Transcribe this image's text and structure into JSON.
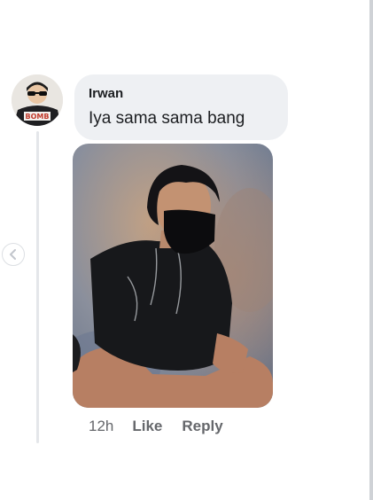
{
  "comment": {
    "author": "Irwan",
    "text": "Iya sama sama bang",
    "avatar_shirt_text": "BOMB",
    "photo": "portrait-photo-man-face-mask",
    "meta": {
      "time": "12h",
      "like_label": "Like",
      "reply_label": "Reply"
    }
  },
  "icons": {
    "prev": "chevron-left-icon"
  },
  "colors": {
    "bubble": "#eef0f3",
    "text": "#1c1e21",
    "meta_text": "#65676b",
    "thread_line": "#e4e6ea"
  }
}
